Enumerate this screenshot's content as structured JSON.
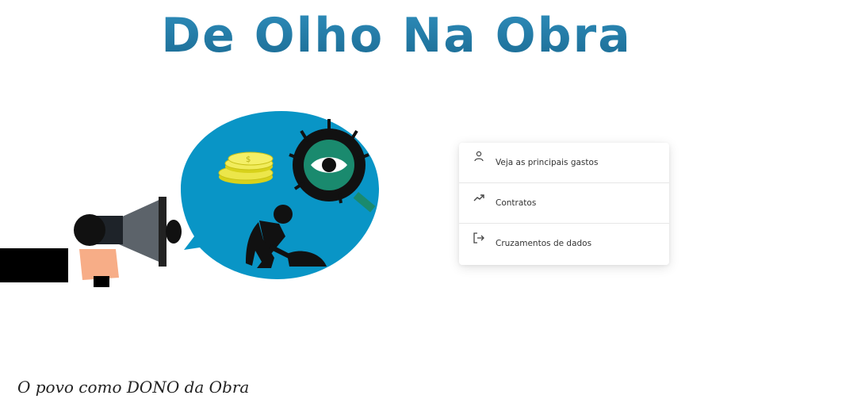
{
  "header": {
    "title": "De Olho Na Obra"
  },
  "menu": {
    "items": [
      {
        "label": "Veja as principais gastos",
        "icon": "person-icon"
      },
      {
        "label": "Contratos",
        "icon": "trending-up-icon"
      },
      {
        "label": "Cruzamentos de dados",
        "icon": "logout-icon"
      }
    ]
  },
  "footer": {
    "tagline": "O povo como DONO da Obra"
  },
  "colors": {
    "title": "#2e8dbb",
    "bubble": "#0995c6",
    "eye_green": "#1a8a6e"
  }
}
